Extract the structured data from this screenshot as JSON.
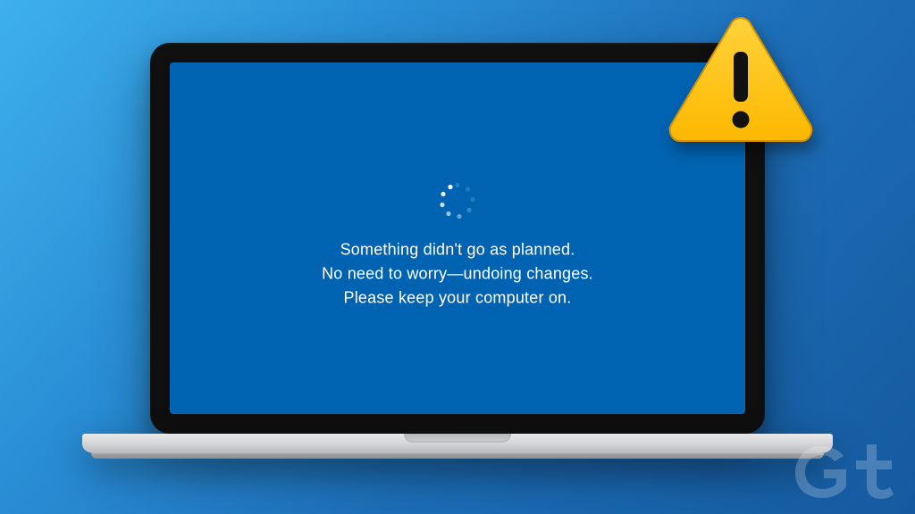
{
  "screen": {
    "message_line1": "Something didn't go as planned.",
    "message_line2": "No need to worry—undoing changes.",
    "message_line3": "Please keep your computer on."
  },
  "warning_icon_name": "warning-triangle-icon",
  "watermark_text": "Gt",
  "colors": {
    "screen_bg": "#0063b1",
    "warning_fill": "#ffc400",
    "warning_stroke": "#d48f00"
  }
}
